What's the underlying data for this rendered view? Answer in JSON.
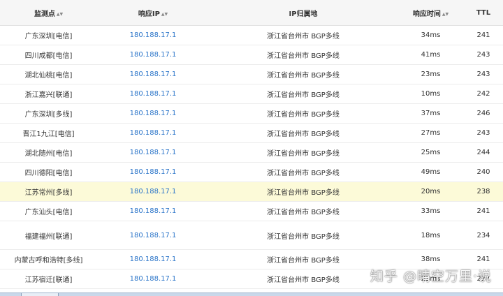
{
  "table": {
    "headers": [
      {
        "label": "监测点",
        "sortable": true
      },
      {
        "label": "响应IP",
        "sortable": true
      },
      {
        "label": "IP归属地",
        "sortable": false
      },
      {
        "label": "响应时间",
        "sortable": true
      },
      {
        "label": "TTL",
        "sortable": false
      }
    ],
    "sort_glyph": "▲▼",
    "rows": [
      {
        "location": "广东深圳[电信]",
        "ip": "180.188.17.1",
        "region": "浙江省台州市 BGP多线",
        "time": "34ms",
        "ttl": "241"
      },
      {
        "location": "四川成都[电信]",
        "ip": "180.188.17.1",
        "region": "浙江省台州市 BGP多线",
        "time": "41ms",
        "ttl": "243"
      },
      {
        "location": "湖北仙桃[电信]",
        "ip": "180.188.17.1",
        "region": "浙江省台州市 BGP多线",
        "time": "23ms",
        "ttl": "243"
      },
      {
        "location": "浙江嘉兴[联通]",
        "ip": "180.188.17.1",
        "region": "浙江省台州市 BGP多线",
        "time": "10ms",
        "ttl": "242"
      },
      {
        "location": "广东深圳[多线]",
        "ip": "180.188.17.1",
        "region": "浙江省台州市 BGP多线",
        "time": "37ms",
        "ttl": "246"
      },
      {
        "location": "晋江1九江[电信]",
        "ip": "180.188.17.1",
        "region": "浙江省台州市 BGP多线",
        "time": "27ms",
        "ttl": "243"
      },
      {
        "location": "湖北随州[电信]",
        "ip": "180.188.17.1",
        "region": "浙江省台州市 BGP多线",
        "time": "25ms",
        "ttl": "244"
      },
      {
        "location": "四川德阳[电信]",
        "ip": "180.188.17.1",
        "region": "浙江省台州市 BGP多线",
        "time": "49ms",
        "ttl": "240"
      },
      {
        "location": "江苏常州[多线]",
        "ip": "180.188.17.1",
        "region": "浙江省台州市 BGP多线",
        "time": "20ms",
        "ttl": "238"
      },
      {
        "location": "广东汕头[电信]",
        "ip": "180.188.17.1",
        "region": "浙江省台州市 BGP多线",
        "time": "33ms",
        "ttl": "241"
      },
      {
        "location": "福建福州[联通]",
        "ip": "180.188.17.1",
        "region": "浙江省台州市 BGP多线",
        "time": "18ms",
        "ttl": "234"
      },
      {
        "location": "内蒙古呼和浩特[多线]",
        "ip": "180.188.17.1",
        "region": "浙江省台州市 BGP多线",
        "time": "38ms",
        "ttl": "241"
      },
      {
        "location": "江苏宿迁[联通]",
        "ip": "180.188.17.1",
        "region": "浙江省台州市 BGP多线",
        "time": "23ms",
        "ttl": "237"
      }
    ],
    "highlight_color": "#fcfad8",
    "ip_color": "#2b75c9"
  },
  "watermark": {
    "text": "知乎 @晴空万里·说"
  }
}
